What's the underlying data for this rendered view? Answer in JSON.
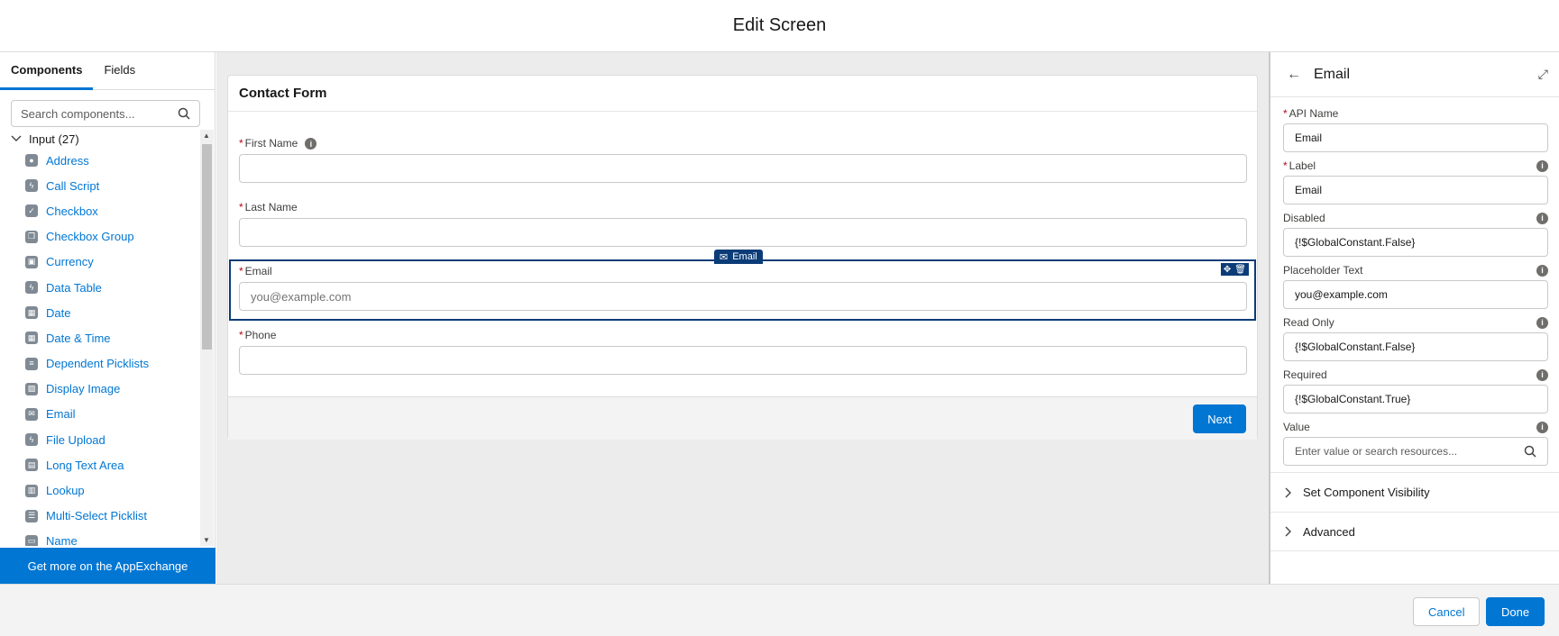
{
  "header": {
    "title": "Edit Screen"
  },
  "left": {
    "tabs": [
      {
        "label": "Components",
        "active": true
      },
      {
        "label": "Fields",
        "active": false
      }
    ],
    "search_placeholder": "Search components...",
    "group_label": "Input (27)",
    "items": [
      {
        "label": "Address",
        "icon": "map-pin-icon"
      },
      {
        "label": "Call Script",
        "icon": "lightning-icon"
      },
      {
        "label": "Checkbox",
        "icon": "checkbox-icon"
      },
      {
        "label": "Checkbox Group",
        "icon": "checkbox-group-icon"
      },
      {
        "label": "Currency",
        "icon": "currency-icon"
      },
      {
        "label": "Data Table",
        "icon": "lightning-icon"
      },
      {
        "label": "Date",
        "icon": "calendar-icon"
      },
      {
        "label": "Date & Time",
        "icon": "calendar-clock-icon"
      },
      {
        "label": "Dependent Picklists",
        "icon": "list-icon"
      },
      {
        "label": "Display Image",
        "icon": "image-icon"
      },
      {
        "label": "Email",
        "icon": "envelope-icon"
      },
      {
        "label": "File Upload",
        "icon": "lightning-icon"
      },
      {
        "label": "Long Text Area",
        "icon": "text-area-icon"
      },
      {
        "label": "Lookup",
        "icon": "lookup-icon"
      },
      {
        "label": "Multi-Select Picklist",
        "icon": "multi-picklist-icon"
      },
      {
        "label": "Name",
        "icon": "name-icon"
      }
    ],
    "appexchange_label": "Get more on the AppExchange"
  },
  "canvas": {
    "card_title": "Contact Form",
    "fields": [
      {
        "label": "First Name",
        "required": true,
        "placeholder": "",
        "has_info": true
      },
      {
        "label": "Last Name",
        "required": true,
        "placeholder": ""
      },
      {
        "label": "Email",
        "required": true,
        "placeholder": "you@example.com",
        "selected": true
      },
      {
        "label": "Phone",
        "required": true,
        "placeholder": ""
      }
    ],
    "selected_tag": "Email",
    "next_label": "Next"
  },
  "right": {
    "title": "Email",
    "props": [
      {
        "label": "API Name",
        "required": true,
        "value": "Email"
      },
      {
        "label": "Label",
        "required": true,
        "value": "Email",
        "info": true
      },
      {
        "label": "Disabled",
        "value": "{!$GlobalConstant.False}",
        "info": true
      },
      {
        "label": "Placeholder Text",
        "value": "you@example.com",
        "info": true
      },
      {
        "label": "Read Only",
        "value": "{!$GlobalConstant.False}",
        "info": true
      },
      {
        "label": "Required",
        "value": "{!$GlobalConstant.True}",
        "info": true
      },
      {
        "label": "Value",
        "placeholder": "Enter value or search resources...",
        "info": true
      }
    ],
    "sections": [
      "Set Component Visibility",
      "Advanced"
    ]
  },
  "footer": {
    "cancel_label": "Cancel",
    "done_label": "Done"
  },
  "colors": {
    "brand": "#0176d3",
    "selected_border": "#0b3c78",
    "required": "#ba0517"
  }
}
